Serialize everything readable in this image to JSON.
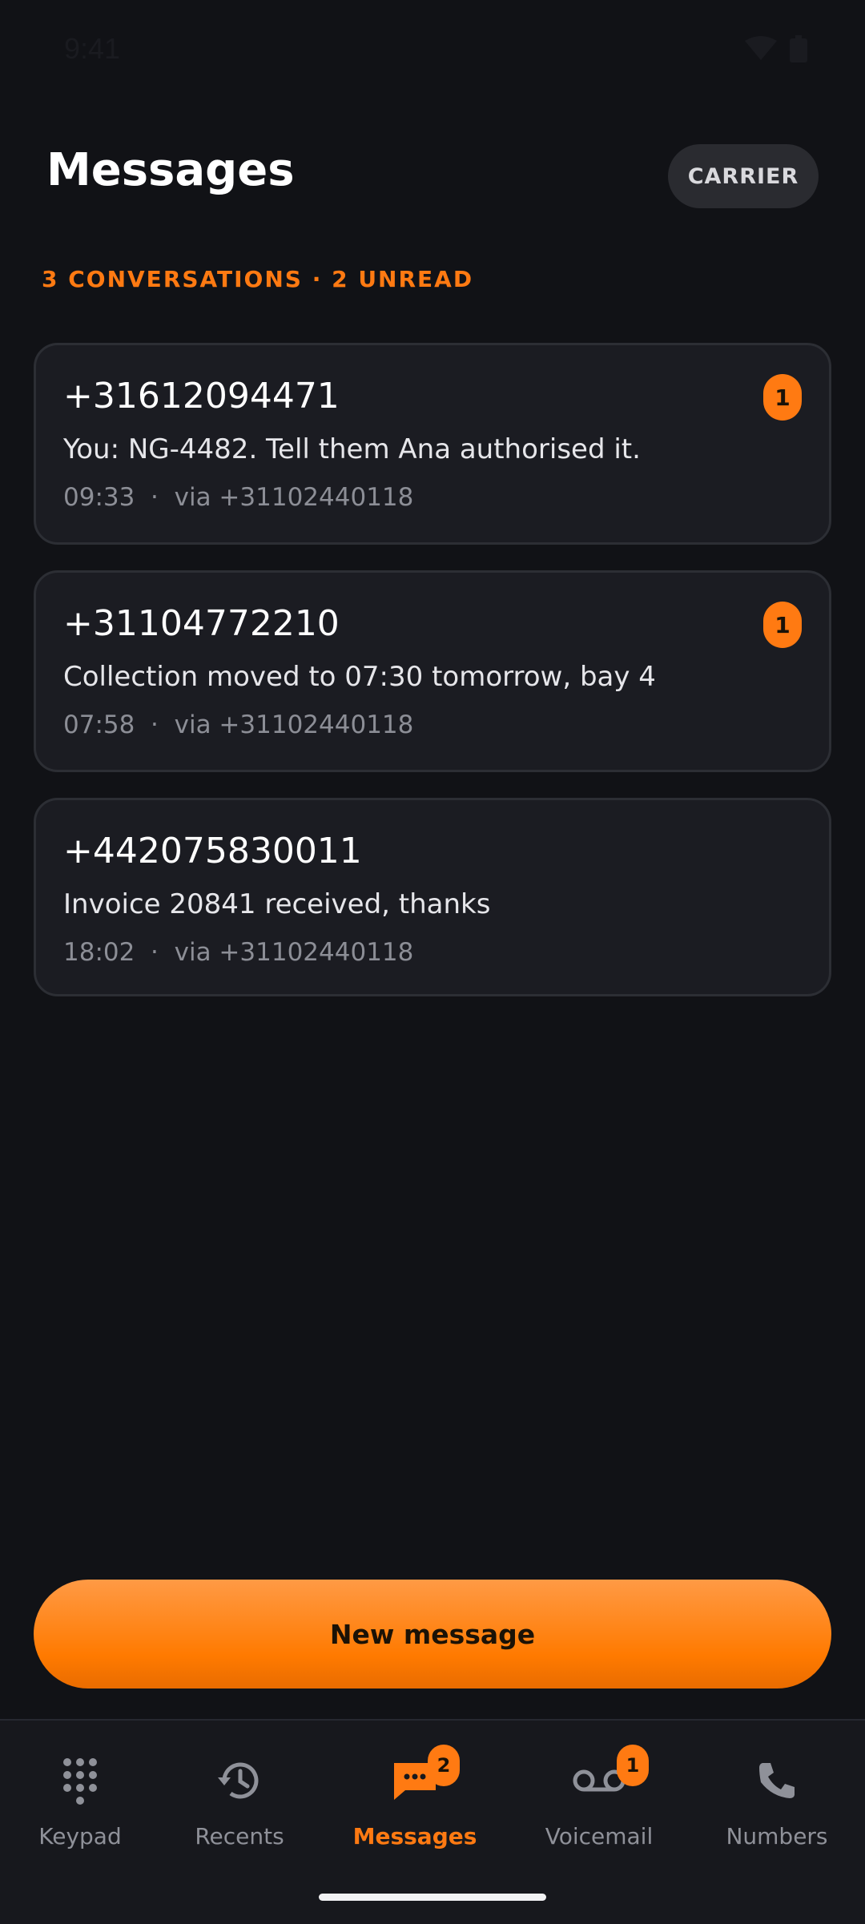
{
  "status": {
    "time": "9:41"
  },
  "header": {
    "title": "Messages",
    "carrier_label": "CARRIER"
  },
  "summary": "3 CONVERSATIONS · 2 UNREAD",
  "conversations": [
    {
      "number": "+31612094471",
      "preview": "You: NG-4482. Tell them Ana authorised it.",
      "time": "09:33",
      "via": "via +31102440118",
      "unread": "1"
    },
    {
      "number": "+31104772210",
      "preview": "Collection moved to 07:30 tomorrow, bay 4",
      "time": "07:58",
      "via": "via +31102440118",
      "unread": "1"
    },
    {
      "number": "+442075830011",
      "preview": "Invoice 20841 received, thanks",
      "time": "18:02",
      "via": "via +31102440118",
      "unread": null
    }
  ],
  "actions": {
    "new_message": "New message"
  },
  "tabs": [
    {
      "label": "Keypad",
      "icon": "keypad-icon",
      "badge": null
    },
    {
      "label": "Recents",
      "icon": "history-icon",
      "badge": null
    },
    {
      "label": "Messages",
      "icon": "chat-icon",
      "badge": "2",
      "active": true
    },
    {
      "label": "Voicemail",
      "icon": "voicemail-icon",
      "badge": "1"
    },
    {
      "label": "Numbers",
      "icon": "phone-icon",
      "badge": null
    }
  ],
  "colors": {
    "accent": "#ff7a12",
    "background": "#111216",
    "card": "#1b1c22"
  }
}
